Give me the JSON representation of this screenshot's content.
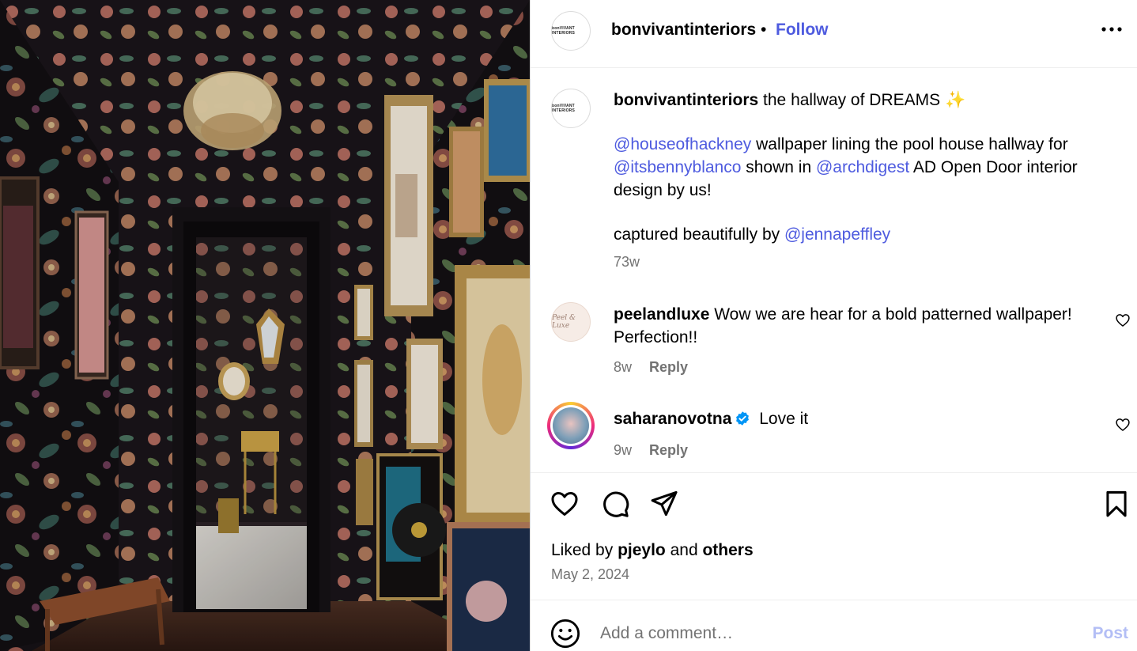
{
  "post": {
    "username": "bonvivantinteriors",
    "avatar_text": "bonVIVANT INTERIORS",
    "separator": "•",
    "follow_label": "Follow",
    "more_icon": "more-horizontal-icon",
    "photo": {
      "subject": "photo"
    }
  },
  "caption": {
    "username": "bonvivantinteriors",
    "line1": " the hallway of DREAMS ✨",
    "para2": {
      "m1": "@houseofhackney",
      "t1": " wallpaper lining the pool house hallway for ",
      "m2": "@itsbennyblanco",
      "t2": " shown in ",
      "m3": "@archdigest",
      "t3": " AD Open Door interior design by us!"
    },
    "para3": {
      "t1": "captured beautifully by ",
      "m1": "@jennapeffley"
    },
    "time": "73w"
  },
  "comments": [
    {
      "username": "peelandluxe",
      "text": " Wow we are hear for a bold patterned wallpaper! Perfection!!",
      "time": "8w",
      "reply_label": "Reply",
      "avatar_text": "Peel & Luxe"
    },
    {
      "username": "saharanovotna",
      "verified": true,
      "text": " Love it",
      "time": "9w",
      "reply_label": "Reply"
    }
  ],
  "actions": {
    "icons": [
      "heart-icon",
      "comment-icon",
      "share-icon",
      "bookmark-icon"
    ],
    "liked_prefix": "Liked by ",
    "liked_user": "pjeylo",
    "liked_mid": " and ",
    "liked_others": "others",
    "date": "May 2, 2024"
  },
  "comment_box": {
    "placeholder": "Add a comment…",
    "post_label": "Post"
  },
  "colors": {
    "link": "#4e5bdf",
    "muted": "#737373",
    "post_disabled": "#b3bef5",
    "verified": "#0095f6"
  }
}
